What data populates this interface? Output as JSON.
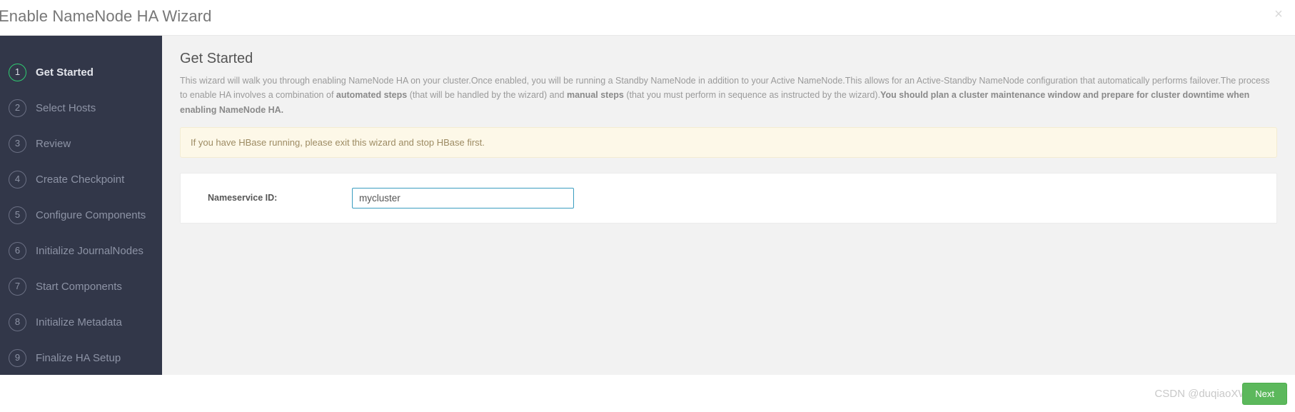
{
  "window": {
    "title": "Enable NameNode HA Wizard",
    "close_icon": "close-icon",
    "close_glyph": "×"
  },
  "sidebar": {
    "steps": [
      {
        "number": "1",
        "label": "Get Started",
        "active": true
      },
      {
        "number": "2",
        "label": "Select Hosts",
        "active": false
      },
      {
        "number": "3",
        "label": "Review",
        "active": false
      },
      {
        "number": "4",
        "label": "Create Checkpoint",
        "active": false
      },
      {
        "number": "5",
        "label": "Configure Components",
        "active": false
      },
      {
        "number": "6",
        "label": "Initialize JournalNodes",
        "active": false
      },
      {
        "number": "7",
        "label": "Start Components",
        "active": false
      },
      {
        "number": "8",
        "label": "Initialize Metadata",
        "active": false
      },
      {
        "number": "9",
        "label": "Finalize HA Setup",
        "active": false
      }
    ]
  },
  "content": {
    "title": "Get Started",
    "description": {
      "part1": "This wizard will walk you through enabling NameNode HA on your cluster.Once enabled, you will be running a Standby NameNode in addition to your Active NameNode.This allows for an Active-Standby NameNode configuration that automatically performs failover.The process to enable HA involves a combination of ",
      "bold1": "automated steps",
      "part2": " (that will be handled by the wizard) and ",
      "bold2": "manual steps",
      "part3": " (that you must perform in sequence as instructed by the wizard).",
      "bold3": "You should plan a cluster maintenance window and prepare for cluster downtime when enabling NameNode HA."
    },
    "warning": "If you have HBase running, please exit this wizard and stop HBase first.",
    "form": {
      "label": "Nameservice ID:",
      "value": "mycluster",
      "placeholder": ""
    }
  },
  "footer": {
    "next_label": "Next",
    "watermark": "CSDN @duqiaoXWang"
  },
  "colors": {
    "sidebar_bg": "#323749",
    "active_step": "#2ecc71",
    "content_bg": "#f2f2f2",
    "warning_bg": "#fdf8e8",
    "input_border": "#3a9dc0",
    "next_button": "#5cb85c"
  }
}
